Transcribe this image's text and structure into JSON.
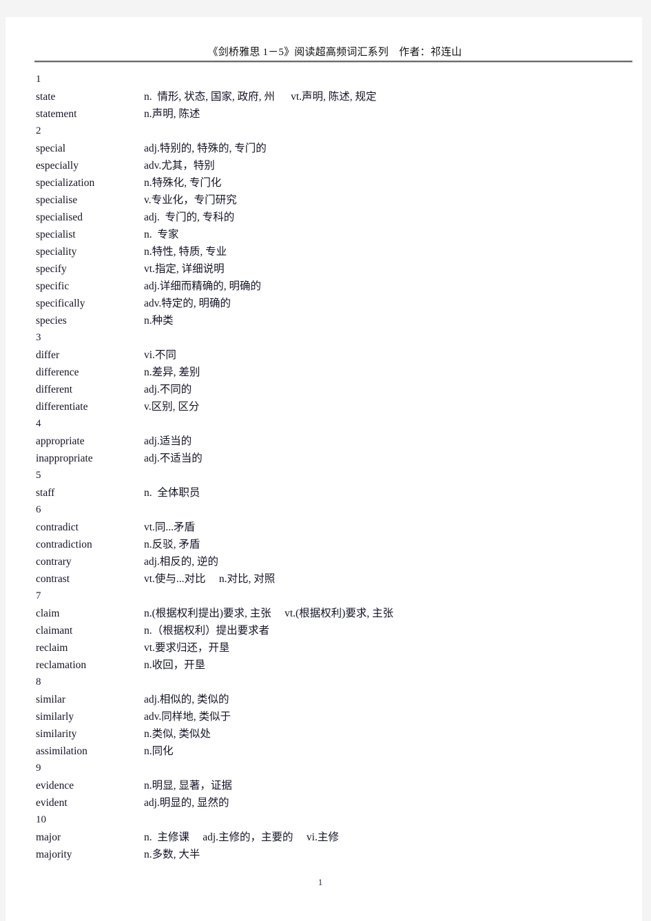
{
  "document": {
    "header_title": "《剑桥雅思 1－5》阅读超高频词汇系列　作者：祁连山",
    "page_number": "1"
  },
  "groups": [
    {
      "number": "1",
      "entries": [
        {
          "word": "state",
          "definition": "n.  情形, 状态, 国家, 政府, 州      vt.声明, 陈述, 规定"
        },
        {
          "word": "statement",
          "definition": "n.声明, 陈述"
        }
      ]
    },
    {
      "number": "2",
      "entries": [
        {
          "word": "special",
          "definition": "adj.特别的, 特殊的, 专门的"
        },
        {
          "word": "especially",
          "definition": "adv.尤其，特别"
        },
        {
          "word": "specialization",
          "definition": "n.特殊化, 专门化"
        },
        {
          "word": "specialise",
          "definition": "v.专业化，专门研究"
        },
        {
          "word": "specialised",
          "definition": "adj.  专门的, 专科的"
        },
        {
          "word": "specialist",
          "definition": "n.  专家"
        },
        {
          "word": "speciality",
          "definition": "n.特性, 特质, 专业"
        },
        {
          "word": "specify",
          "definition": "vt.指定, 详细说明"
        },
        {
          "word": "specific",
          "definition": "adj.详细而精确的, 明确的"
        },
        {
          "word": "specifically",
          "definition": "adv.特定的, 明确的"
        },
        {
          "word": "species",
          "definition": "n.种类"
        }
      ]
    },
    {
      "number": "3",
      "entries": [
        {
          "word": "differ",
          "definition": "vi.不同"
        },
        {
          "word": "difference",
          "definition": "n.差异, 差别"
        },
        {
          "word": "different",
          "definition": "adj.不同的"
        },
        {
          "word": "differentiate",
          "definition": "v.区别, 区分"
        }
      ]
    },
    {
      "number": "4",
      "entries": [
        {
          "word": "appropriate",
          "definition": "adj.适当的"
        },
        {
          "word": "inappropriate",
          "definition": "adj.不适当的"
        }
      ]
    },
    {
      "number": "5",
      "entries": [
        {
          "word": "staff",
          "definition": "n.  全体职员"
        }
      ]
    },
    {
      "number": "6",
      "entries": [
        {
          "word": "contradict",
          "definition": "vt.同...矛盾"
        },
        {
          "word": "contradiction",
          "definition": "n.反驳, 矛盾"
        },
        {
          "word": "contrary",
          "definition": "adj.相反的, 逆的"
        },
        {
          "word": "contrast",
          "definition": "vt.使与...对比　 n.对比, 对照"
        }
      ]
    },
    {
      "number": "7",
      "entries": [
        {
          "word": "claim",
          "definition": "n.(根据权利提出)要求, 主张　 vt.(根据权利)要求, 主张"
        },
        {
          "word": "claimant",
          "definition": "n.（根据权利）提出要求者"
        },
        {
          "word": "reclaim",
          "definition": "vt.要求归还，开垦"
        },
        {
          "word": "reclamation",
          "definition": "n.收回，开垦"
        }
      ]
    },
    {
      "number": "8",
      "entries": [
        {
          "word": "similar",
          "definition": "adj.相似的, 类似的"
        },
        {
          "word": "similarly",
          "definition": "adv.同样地, 类似于"
        },
        {
          "word": "similarity",
          "definition": "n.类似, 类似处"
        },
        {
          "word": "assimilation",
          "definition": "n.同化"
        }
      ]
    },
    {
      "number": "9",
      "entries": [
        {
          "word": "evidence",
          "definition": "n.明显, 显著，证据"
        },
        {
          "word": "evident",
          "definition": "adj.明显的, 显然的"
        }
      ]
    },
    {
      "number": "10",
      "entries": [
        {
          "word": "major",
          "definition": "n.  主修课　 adj.主修的，主要的　 vi.主修"
        },
        {
          "word": "majority",
          "definition": "n.多数, 大半"
        }
      ]
    }
  ]
}
